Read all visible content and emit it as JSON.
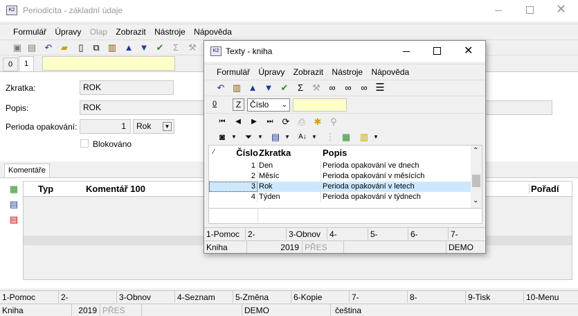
{
  "main": {
    "title": "Periodicita - základní údaje",
    "menu": [
      "Formulář",
      "Úpravy",
      "Olap",
      "Zobrazit",
      "Nástroje",
      "Nápověda"
    ],
    "tabs": [
      "0",
      "1"
    ],
    "fields": {
      "zkratka_label": "Zkratka:",
      "zkratka_value": "ROK",
      "popis_label": "Popis:",
      "popis_value": "ROK",
      "perioda_label": "Perioda opakování:",
      "perioda_number": "1",
      "perioda_unit": "Rok",
      "blokovano_label": "Blokováno"
    },
    "komentare_tab": "Komentáře",
    "table_headers": {
      "typ": "Typ",
      "komentar": "Komentář 100",
      "poradi": "Pořadí"
    },
    "fkeys": [
      "1-Pomoc",
      "2-",
      "3-Obnov",
      "4-Seznam",
      "5-Změna",
      "6-Kopie",
      "7-",
      "8-",
      "9-Tisk",
      "10-Menu"
    ],
    "status": [
      "Kniha",
      "2019",
      "PŘES",
      "",
      "DEMO",
      "",
      "čeština"
    ]
  },
  "dialog": {
    "title": "Texty - kniha",
    "menu": [
      "Formulář",
      "Úpravy",
      "Zobrazit",
      "Nástroje",
      "Nápověda"
    ],
    "tab0": "0",
    "z_button": "Z",
    "sort_select": "Číslo",
    "columns": {
      "cislo": "Číslo",
      "zkratka": "Zkratka",
      "popis": "Popis"
    },
    "rows": [
      {
        "cislo": "1",
        "zkratka": "Den",
        "popis": "Perioda opakování ve dnech"
      },
      {
        "cislo": "2",
        "zkratka": "Měsíc",
        "popis": "Perioda opakování v měsících"
      },
      {
        "cislo": "3",
        "zkratka": "Rok",
        "popis": "Perioda opakování v letech"
      },
      {
        "cislo": "4",
        "zkratka": "Týden",
        "popis": "Perioda opakování v týdnech"
      }
    ],
    "fkeys": [
      "1-Pomoc",
      "2-",
      "3-Obnov",
      "4-",
      "5-",
      "6-",
      "7-"
    ],
    "status": [
      "Kniha",
      "2019",
      "PŘES",
      "",
      "DEMO"
    ]
  },
  "colors": {
    "accent_yellow": "#ffffc8",
    "selection": "#cce8ff",
    "toolbar_blue": "#1f3a93"
  }
}
